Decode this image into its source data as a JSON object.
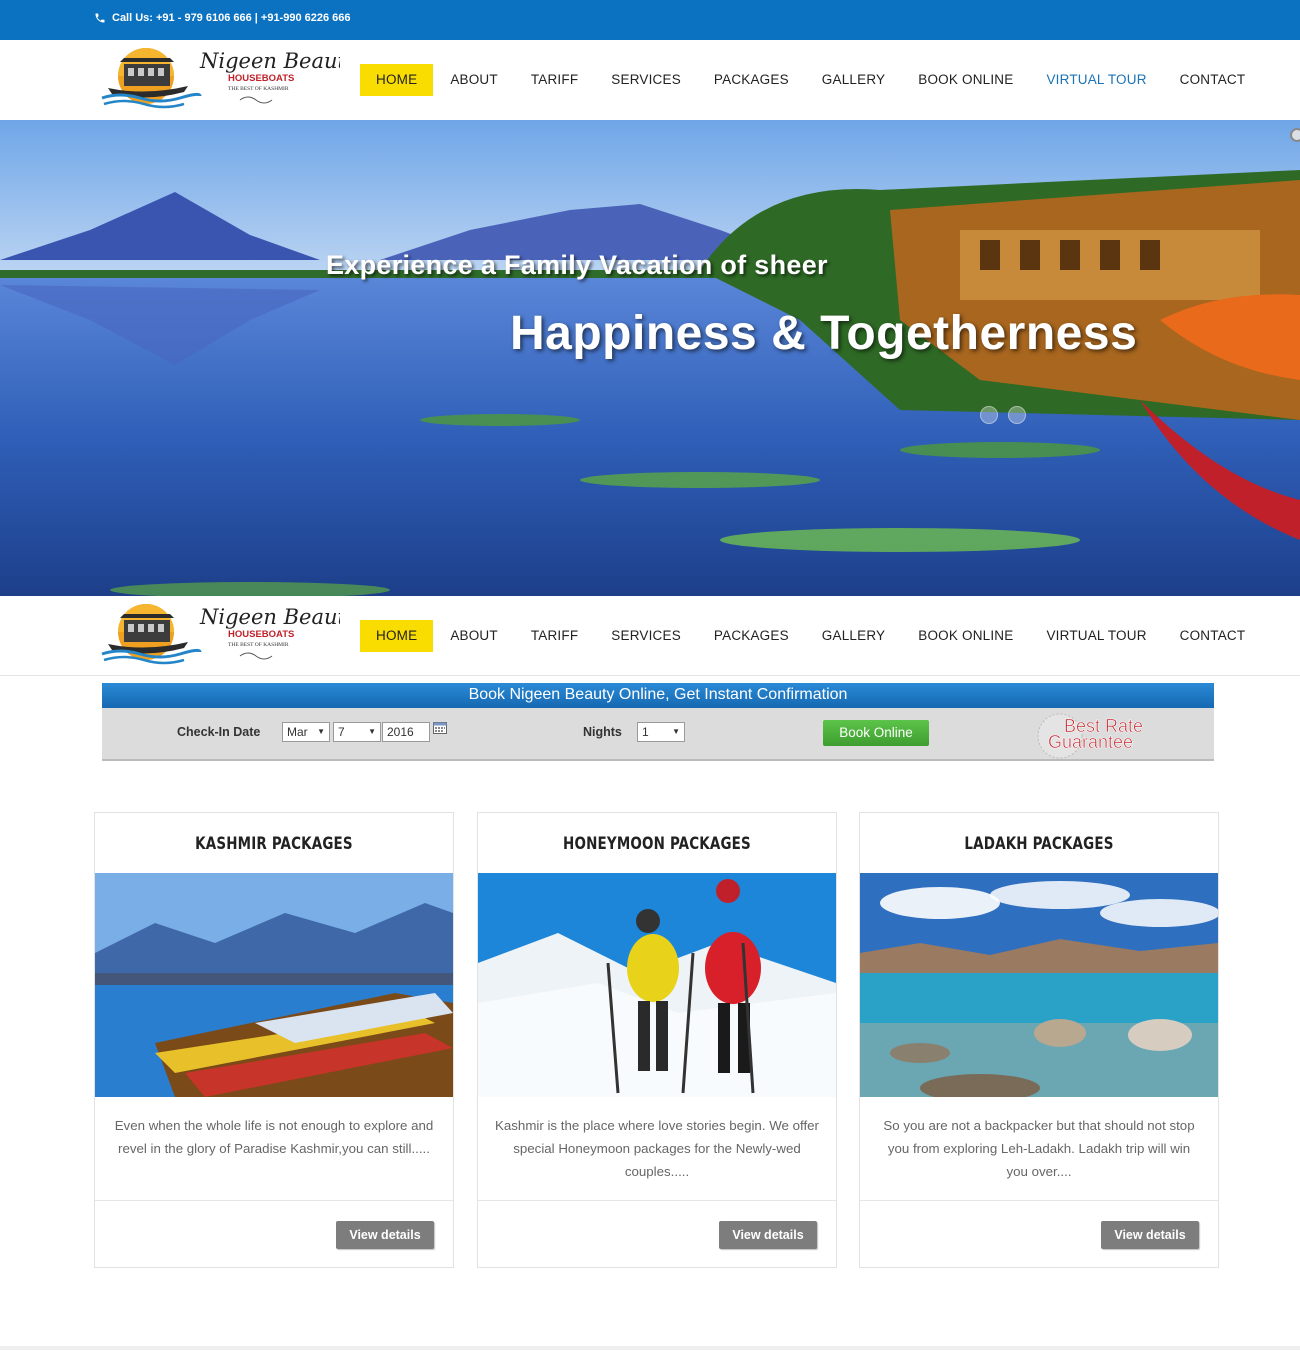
{
  "topbar": {
    "call_text": "Call Us: +91 - 979 6106 666 | +91-990 6226 666"
  },
  "brand": {
    "name": "Nigeen Beauty",
    "sub": "HOUSEBOATS",
    "tagline": "THE BEST OF KASHMIR"
  },
  "nav": {
    "items": [
      {
        "label": "HOME"
      },
      {
        "label": "ABOUT"
      },
      {
        "label": "TARIFF"
      },
      {
        "label": "SERVICES"
      },
      {
        "label": "PACKAGES"
      },
      {
        "label": "GALLERY"
      },
      {
        "label": "BOOK ONLINE"
      },
      {
        "label": "VIRTUAL TOUR"
      },
      {
        "label": "CONTACT"
      }
    ]
  },
  "hero": {
    "line1": "Experience a Family Vacation of sheer",
    "line2": "Happiness & Togetherness"
  },
  "booking": {
    "header": "Book Nigeen Beauty Online, Get Instant Confirmation",
    "checkin_label": "Check-In Date",
    "month": "Mar",
    "day": "7",
    "year": "2016",
    "nights_label": "Nights",
    "nights": "1",
    "button": "Book Online",
    "badge_line1": "Best Rate",
    "badge_line2": "Guarantee"
  },
  "packages": [
    {
      "title": "KASHMIR PACKAGES",
      "desc": "Even when the whole life is not enough to explore and revel in the glory of Paradise Kashmir,you can still.....",
      "button": "View details"
    },
    {
      "title": "HONEYMOON PACKAGES",
      "desc": "Kashmir is the place where love stories begin. We offer special Honeymoon packages for the Newly-wed couples.....",
      "button": "View details"
    },
    {
      "title": "LADAKH PACKAGES",
      "desc": "So you are not a backpacker but that should not stop you from exploring Leh-Ladakh. Ladakh trip will win you over....",
      "button": "View details"
    }
  ]
}
